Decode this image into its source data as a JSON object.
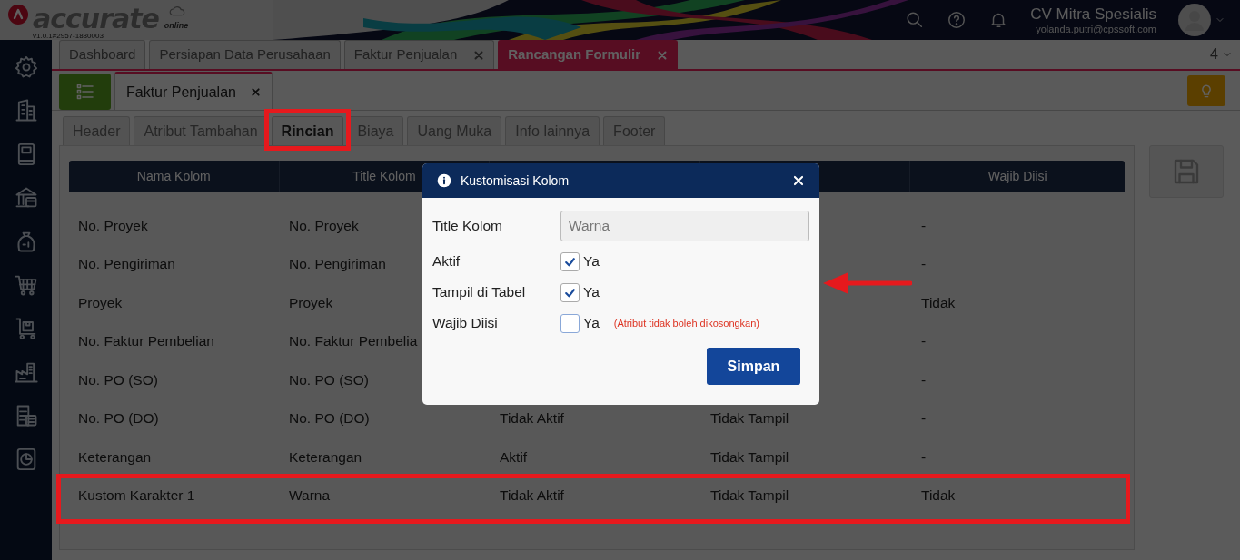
{
  "app": {
    "logo_text": "accurate",
    "version": "v1.0.1#2957-1880003",
    "logo_subtitle": "online"
  },
  "header": {
    "company": "CV Mitra Spesialis",
    "email": "yolanda.putri@cpssoft.com"
  },
  "main_tabs": [
    {
      "label": "Dashboard",
      "selected": false,
      "closable": false
    },
    {
      "label": "Persiapan Data Perusahaan",
      "selected": false,
      "closable": false
    },
    {
      "label": "Faktur Penjualan",
      "selected": false,
      "closable": true
    },
    {
      "label": "Rancangan Formulir",
      "selected": true,
      "closable": true
    }
  ],
  "tab_count": "4",
  "document_tab": {
    "label": "Faktur Penjualan"
  },
  "sub_tabs": [
    {
      "label": "Header",
      "selected": false
    },
    {
      "label": "Atribut Tambahan",
      "selected": false
    },
    {
      "label": "Rincian",
      "selected": true
    },
    {
      "label": "Biaya",
      "selected": false
    },
    {
      "label": "Uang Muka",
      "selected": false
    },
    {
      "label": "Info lainnya",
      "selected": false
    },
    {
      "label": "Footer",
      "selected": false
    }
  ],
  "table": {
    "columns": {
      "nama_kolom": "Nama Kolom",
      "title_kolom": "Title Kolom",
      "wajib_diisi": "Wajib Diisi"
    },
    "rows": [
      {
        "nama_kolom": "No. Proyek",
        "title_kolom": "No. Proyek",
        "wajib_diisi": "-"
      },
      {
        "nama_kolom": "No. Pengiriman",
        "title_kolom": "No. Pengiriman",
        "wajib_diisi": "-"
      },
      {
        "nama_kolom": "Proyek",
        "title_kolom": "Proyek",
        "wajib_diisi": "Tidak"
      },
      {
        "nama_kolom": "No. Faktur Pembelian",
        "title_kolom": "No. Faktur Pembelia",
        "wajib_diisi": "-"
      },
      {
        "nama_kolom": "No. PO (SO)",
        "title_kolom": "No. PO (SO)",
        "wajib_diisi": "-"
      },
      {
        "nama_kolom": "No. PO (DO)",
        "title_kolom": "No. PO (DO)",
        "column_3": "Tidak Aktif",
        "column_4": "Tidak Tampil",
        "wajib_diisi": "-"
      },
      {
        "nama_kolom": "Keterangan",
        "title_kolom": "Keterangan",
        "column_3": "Aktif",
        "column_4": "Tidak Tampil",
        "wajib_diisi": "-"
      },
      {
        "nama_kolom": "Kustom Karakter 1",
        "title_kolom": "Warna",
        "column_3": "Tidak Aktif",
        "column_4": "Tidak Tampil",
        "wajib_diisi": "Tidak"
      }
    ]
  },
  "modal": {
    "title": "Kustomisasi Kolom",
    "field": {
      "label": "Title Kolom",
      "value": "Warna"
    },
    "checks": [
      {
        "label": "Aktif",
        "option": "Ya",
        "checked": true
      },
      {
        "label": "Tampil di Tabel",
        "option": "Ya",
        "checked": true
      },
      {
        "label": "Wajib Diisi",
        "option": "Ya",
        "checked": false,
        "note": "(Atribut tidak boleh dikosongkan)"
      }
    ],
    "button": "Simpan"
  }
}
